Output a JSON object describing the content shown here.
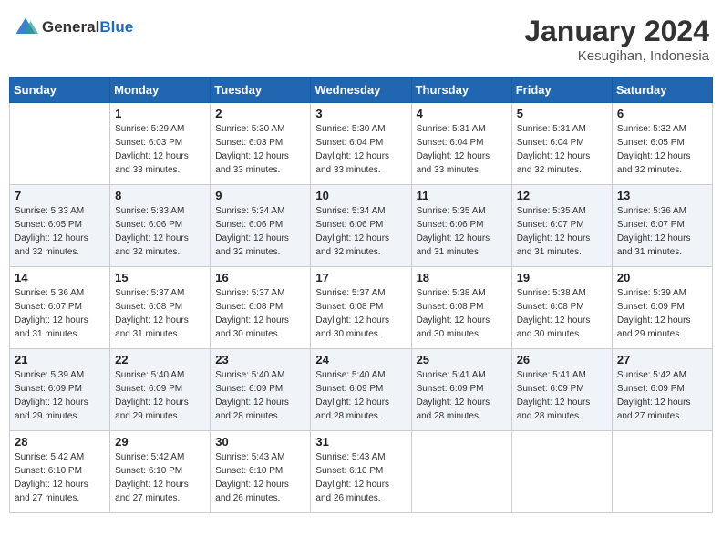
{
  "logo": {
    "general": "General",
    "blue": "Blue"
  },
  "header": {
    "month": "January 2024",
    "location": "Kesugihan, Indonesia"
  },
  "columns": [
    "Sunday",
    "Monday",
    "Tuesday",
    "Wednesday",
    "Thursday",
    "Friday",
    "Saturday"
  ],
  "weeks": [
    [
      {
        "day": "",
        "info": ""
      },
      {
        "day": "1",
        "info": "Sunrise: 5:29 AM\nSunset: 6:03 PM\nDaylight: 12 hours\nand 33 minutes."
      },
      {
        "day": "2",
        "info": "Sunrise: 5:30 AM\nSunset: 6:03 PM\nDaylight: 12 hours\nand 33 minutes."
      },
      {
        "day": "3",
        "info": "Sunrise: 5:30 AM\nSunset: 6:04 PM\nDaylight: 12 hours\nand 33 minutes."
      },
      {
        "day": "4",
        "info": "Sunrise: 5:31 AM\nSunset: 6:04 PM\nDaylight: 12 hours\nand 33 minutes."
      },
      {
        "day": "5",
        "info": "Sunrise: 5:31 AM\nSunset: 6:04 PM\nDaylight: 12 hours\nand 32 minutes."
      },
      {
        "day": "6",
        "info": "Sunrise: 5:32 AM\nSunset: 6:05 PM\nDaylight: 12 hours\nand 32 minutes."
      }
    ],
    [
      {
        "day": "7",
        "info": "Sunrise: 5:33 AM\nSunset: 6:05 PM\nDaylight: 12 hours\nand 32 minutes."
      },
      {
        "day": "8",
        "info": "Sunrise: 5:33 AM\nSunset: 6:06 PM\nDaylight: 12 hours\nand 32 minutes."
      },
      {
        "day": "9",
        "info": "Sunrise: 5:34 AM\nSunset: 6:06 PM\nDaylight: 12 hours\nand 32 minutes."
      },
      {
        "day": "10",
        "info": "Sunrise: 5:34 AM\nSunset: 6:06 PM\nDaylight: 12 hours\nand 32 minutes."
      },
      {
        "day": "11",
        "info": "Sunrise: 5:35 AM\nSunset: 6:06 PM\nDaylight: 12 hours\nand 31 minutes."
      },
      {
        "day": "12",
        "info": "Sunrise: 5:35 AM\nSunset: 6:07 PM\nDaylight: 12 hours\nand 31 minutes."
      },
      {
        "day": "13",
        "info": "Sunrise: 5:36 AM\nSunset: 6:07 PM\nDaylight: 12 hours\nand 31 minutes."
      }
    ],
    [
      {
        "day": "14",
        "info": "Sunrise: 5:36 AM\nSunset: 6:07 PM\nDaylight: 12 hours\nand 31 minutes."
      },
      {
        "day": "15",
        "info": "Sunrise: 5:37 AM\nSunset: 6:08 PM\nDaylight: 12 hours\nand 31 minutes."
      },
      {
        "day": "16",
        "info": "Sunrise: 5:37 AM\nSunset: 6:08 PM\nDaylight: 12 hours\nand 30 minutes."
      },
      {
        "day": "17",
        "info": "Sunrise: 5:37 AM\nSunset: 6:08 PM\nDaylight: 12 hours\nand 30 minutes."
      },
      {
        "day": "18",
        "info": "Sunrise: 5:38 AM\nSunset: 6:08 PM\nDaylight: 12 hours\nand 30 minutes."
      },
      {
        "day": "19",
        "info": "Sunrise: 5:38 AM\nSunset: 6:08 PM\nDaylight: 12 hours\nand 30 minutes."
      },
      {
        "day": "20",
        "info": "Sunrise: 5:39 AM\nSunset: 6:09 PM\nDaylight: 12 hours\nand 29 minutes."
      }
    ],
    [
      {
        "day": "21",
        "info": "Sunrise: 5:39 AM\nSunset: 6:09 PM\nDaylight: 12 hours\nand 29 minutes."
      },
      {
        "day": "22",
        "info": "Sunrise: 5:40 AM\nSunset: 6:09 PM\nDaylight: 12 hours\nand 29 minutes."
      },
      {
        "day": "23",
        "info": "Sunrise: 5:40 AM\nSunset: 6:09 PM\nDaylight: 12 hours\nand 28 minutes."
      },
      {
        "day": "24",
        "info": "Sunrise: 5:40 AM\nSunset: 6:09 PM\nDaylight: 12 hours\nand 28 minutes."
      },
      {
        "day": "25",
        "info": "Sunrise: 5:41 AM\nSunset: 6:09 PM\nDaylight: 12 hours\nand 28 minutes."
      },
      {
        "day": "26",
        "info": "Sunrise: 5:41 AM\nSunset: 6:09 PM\nDaylight: 12 hours\nand 28 minutes."
      },
      {
        "day": "27",
        "info": "Sunrise: 5:42 AM\nSunset: 6:09 PM\nDaylight: 12 hours\nand 27 minutes."
      }
    ],
    [
      {
        "day": "28",
        "info": "Sunrise: 5:42 AM\nSunset: 6:10 PM\nDaylight: 12 hours\nand 27 minutes."
      },
      {
        "day": "29",
        "info": "Sunrise: 5:42 AM\nSunset: 6:10 PM\nDaylight: 12 hours\nand 27 minutes."
      },
      {
        "day": "30",
        "info": "Sunrise: 5:43 AM\nSunset: 6:10 PM\nDaylight: 12 hours\nand 26 minutes."
      },
      {
        "day": "31",
        "info": "Sunrise: 5:43 AM\nSunset: 6:10 PM\nDaylight: 12 hours\nand 26 minutes."
      },
      {
        "day": "",
        "info": ""
      },
      {
        "day": "",
        "info": ""
      },
      {
        "day": "",
        "info": ""
      }
    ]
  ]
}
